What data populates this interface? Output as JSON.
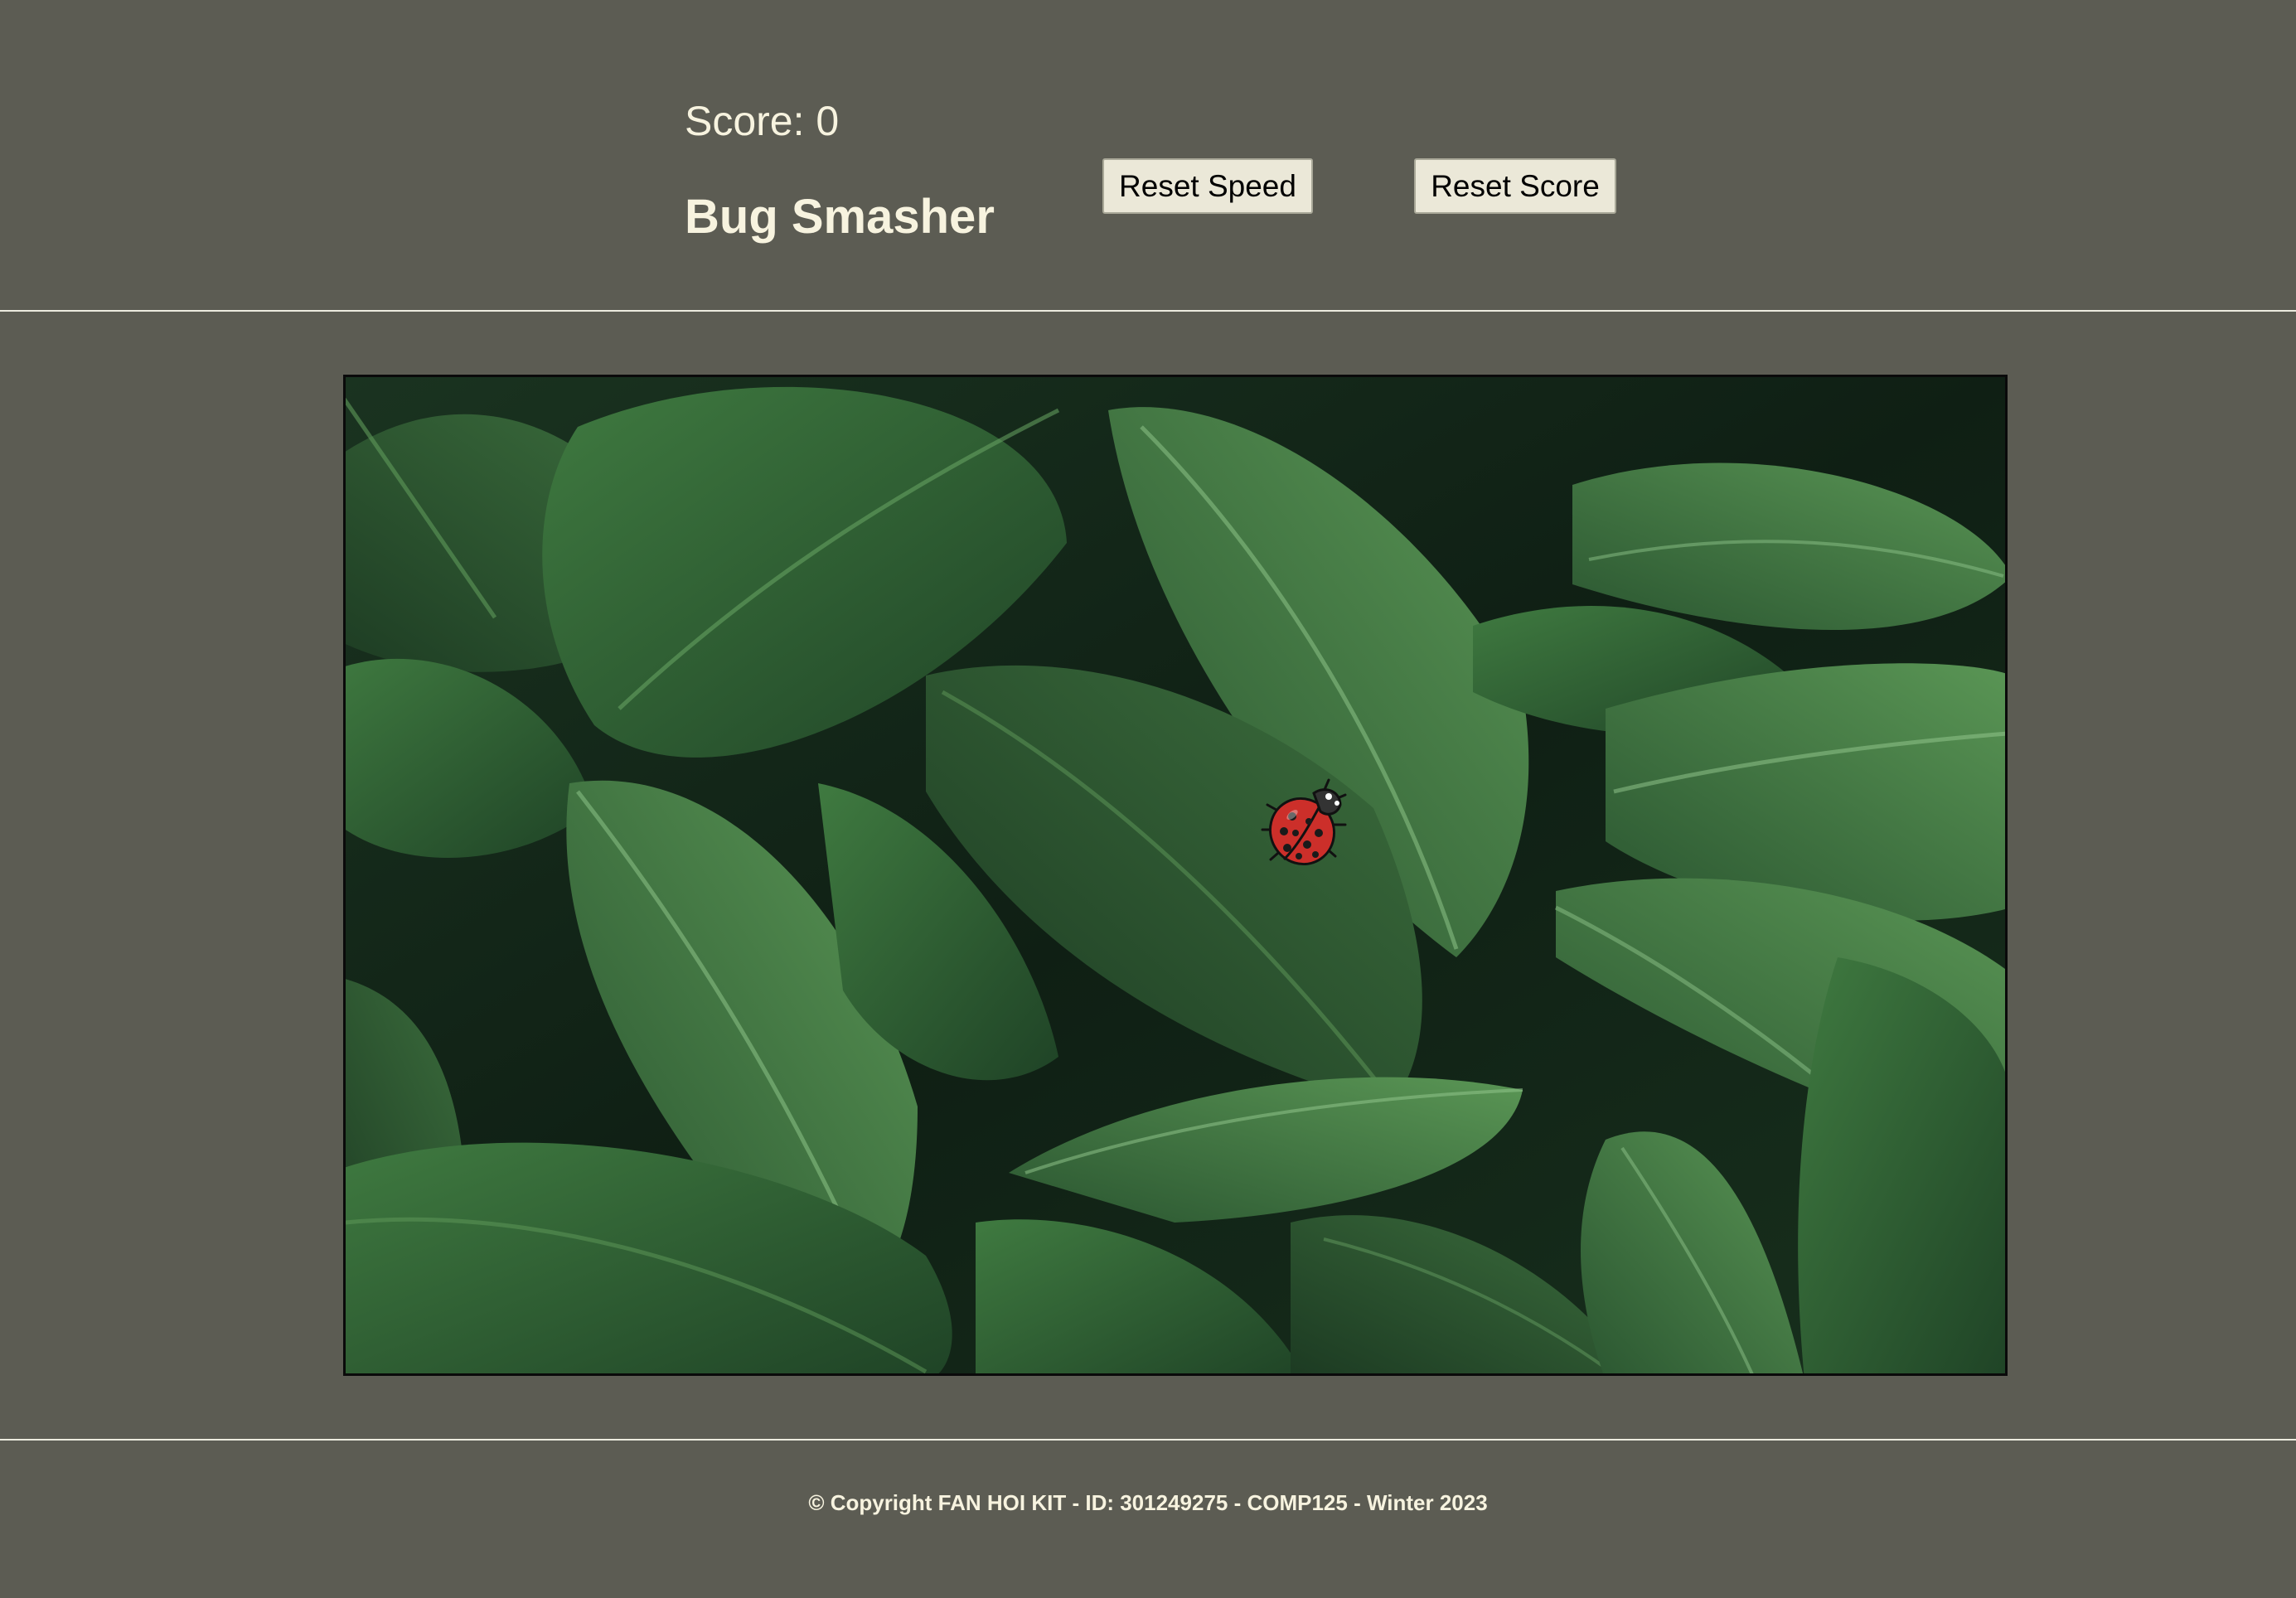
{
  "header": {
    "score_text": "Score: 0",
    "title": "Bug Smasher",
    "reset_speed_label": "Reset Speed",
    "reset_score_label": "Reset Score"
  },
  "game": {
    "score": 0,
    "background": "tropical green leaves",
    "sprite": "ladybug-icon"
  },
  "footer": {
    "copyright": "© Copyright FAN HOI KIT - ID: 301249275 - COMP125 - Winter 2023"
  },
  "colors": {
    "page_background": "#5c5c53",
    "text": "#f7f3df",
    "button_background": "#ebe8d8",
    "leaf_dark": "#1e3d24",
    "leaf_light": "#4e8a4e",
    "ladybug_red": "#cc2f2a"
  }
}
